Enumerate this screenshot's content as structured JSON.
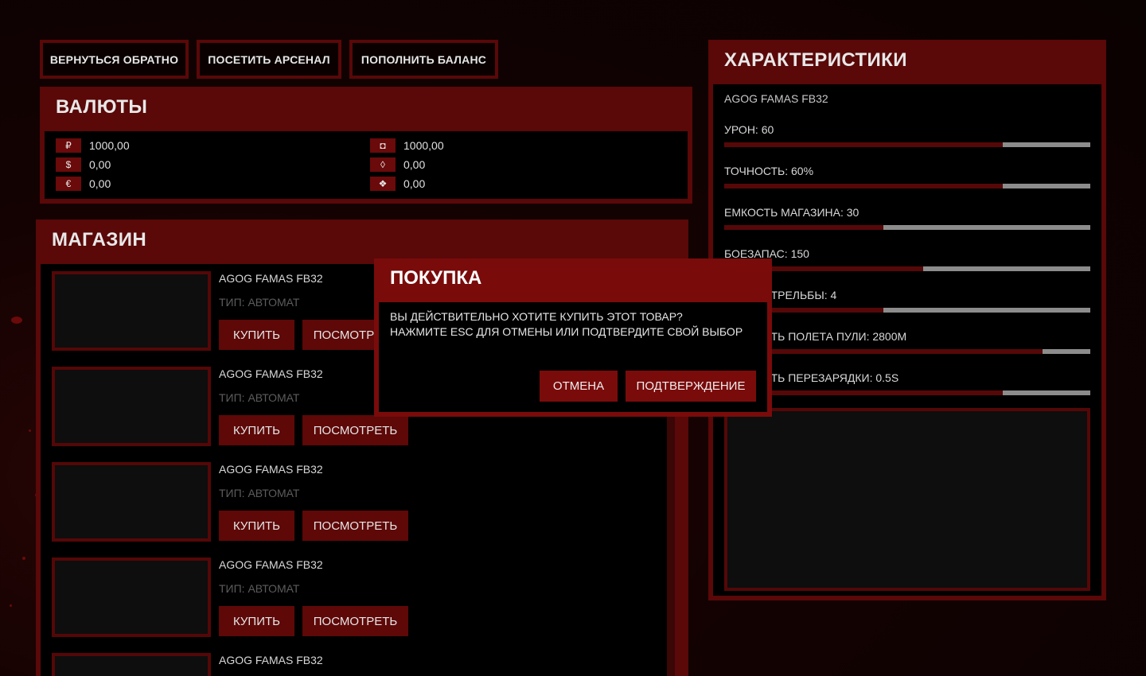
{
  "nav": {
    "back": "ВЕРНУТЬСЯ ОБРАТНО",
    "arsenal": "ПОСЕТИТЬ АРСЕНАЛ",
    "balance": "ПОПОЛНИТЬ БАЛАНС"
  },
  "currencies": {
    "title": "ВАЛЮТЫ",
    "left": [
      {
        "icon": "₽",
        "value": "1000,00"
      },
      {
        "icon": "$",
        "value": "0,00"
      },
      {
        "icon": "€",
        "value": "0,00"
      }
    ],
    "right": [
      {
        "icon": "◘",
        "value": "1000,00"
      },
      {
        "icon": "◊",
        "value": "0,00"
      },
      {
        "icon": "❖",
        "value": "0,00"
      }
    ]
  },
  "shop": {
    "title": "МАГАЗИН",
    "buy_label": "КУПИТЬ",
    "view_label": "ПОСМОТРЕТЬ",
    "items": [
      {
        "name": "AGOG FAMAS FB32",
        "type": "ТИП: АВТОМАТ"
      },
      {
        "name": "AGOG FAMAS FB32",
        "type": "ТИП: АВТОМАТ"
      },
      {
        "name": "AGOG FAMAS FB32",
        "type": "ТИП: АВТОМАТ"
      },
      {
        "name": "AGOG FAMAS FB32",
        "type": "ТИП: АВТОМАТ"
      },
      {
        "name": "AGOG FAMAS FB32",
        "type": ""
      }
    ]
  },
  "stats": {
    "title": "ХАРАКТЕРИСТИКИ",
    "weapon": "AGOG FAMAS FB32",
    "items": [
      {
        "label": "УРОН: 60",
        "fraction": 0.76
      },
      {
        "label": "ТОЧНОСТЬ: 60%",
        "fraction": 0.76
      },
      {
        "label": "ЕМКОСТЬ МАГАЗИНА: 30",
        "fraction": 0.435
      },
      {
        "label": "БОЕЗАПАС: 150",
        "fraction": 0.543
      },
      {
        "label": "СКОРОСТРЕЛЬБЫ: 4",
        "fraction": 0.435
      },
      {
        "label": "СКОРОСТЬ ПОЛЕТА ПУЛИ: 2800М",
        "fraction": 0.87
      },
      {
        "label": "СКОРОСТЬ ПЕРЕЗАРЯДКИ: 0.5S",
        "fraction": 0.76
      }
    ]
  },
  "modal": {
    "title": "ПОКУПКА",
    "line1": "ВЫ ДЕЙСТВИТЕЛЬНО ХОТИТЕ КУПИТЬ ЭТОТ ТОВАР?",
    "line2": "НАЖМИТЕ ESC ДЛЯ ОТМЕНЫ ИЛИ ПОДТВЕРДИТЕ СВОЙ ВЫБОР",
    "cancel": "ОТМЕНА",
    "confirm": "ПОДТВЕРЖДЕНИЕ"
  }
}
